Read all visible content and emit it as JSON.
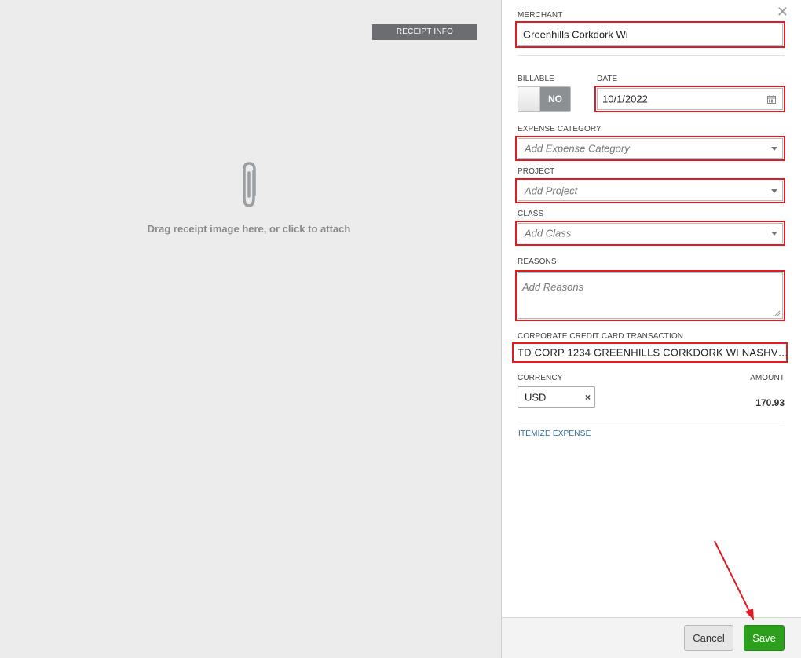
{
  "receipt": {
    "info_button": "RECEIPT INFO",
    "drop_text": "Drag receipt image here, or click to attach"
  },
  "form": {
    "merchant": {
      "label": "MERCHANT",
      "value": "Greenhills Corkdork Wi"
    },
    "billable": {
      "label": "BILLABLE",
      "state": "NO"
    },
    "date": {
      "label": "DATE",
      "value": "10/1/2022"
    },
    "expense_category": {
      "label": "EXPENSE CATEGORY",
      "placeholder": "Add Expense Category"
    },
    "project": {
      "label": "PROJECT",
      "placeholder": "Add Project"
    },
    "class": {
      "label": "CLASS",
      "placeholder": "Add Class"
    },
    "reasons": {
      "label": "REASONS",
      "placeholder": "Add Reasons"
    },
    "cc_transaction": {
      "label": "CORPORATE CREDIT CARD TRANSACTION",
      "value": "TD CORP 1234 GREENHILLS CORKDORK WI NASHV…"
    },
    "currency": {
      "label": "CURRENCY",
      "value": "USD",
      "clear": "×"
    },
    "amount": {
      "label": "AMOUNT",
      "value": "170.93"
    },
    "itemize_link": "ITEMIZE EXPENSE"
  },
  "footer": {
    "cancel": "Cancel",
    "save": "Save"
  },
  "colors": {
    "highlight": "#e01b22",
    "save_button": "#2ca01c",
    "link": "#2b6aa0",
    "toggle_off": "#8c8f93"
  },
  "icons": [
    "paperclip-icon",
    "close-icon",
    "calendar-icon",
    "chevron-down-icon",
    "resize-grip-icon",
    "clear-icon"
  ]
}
